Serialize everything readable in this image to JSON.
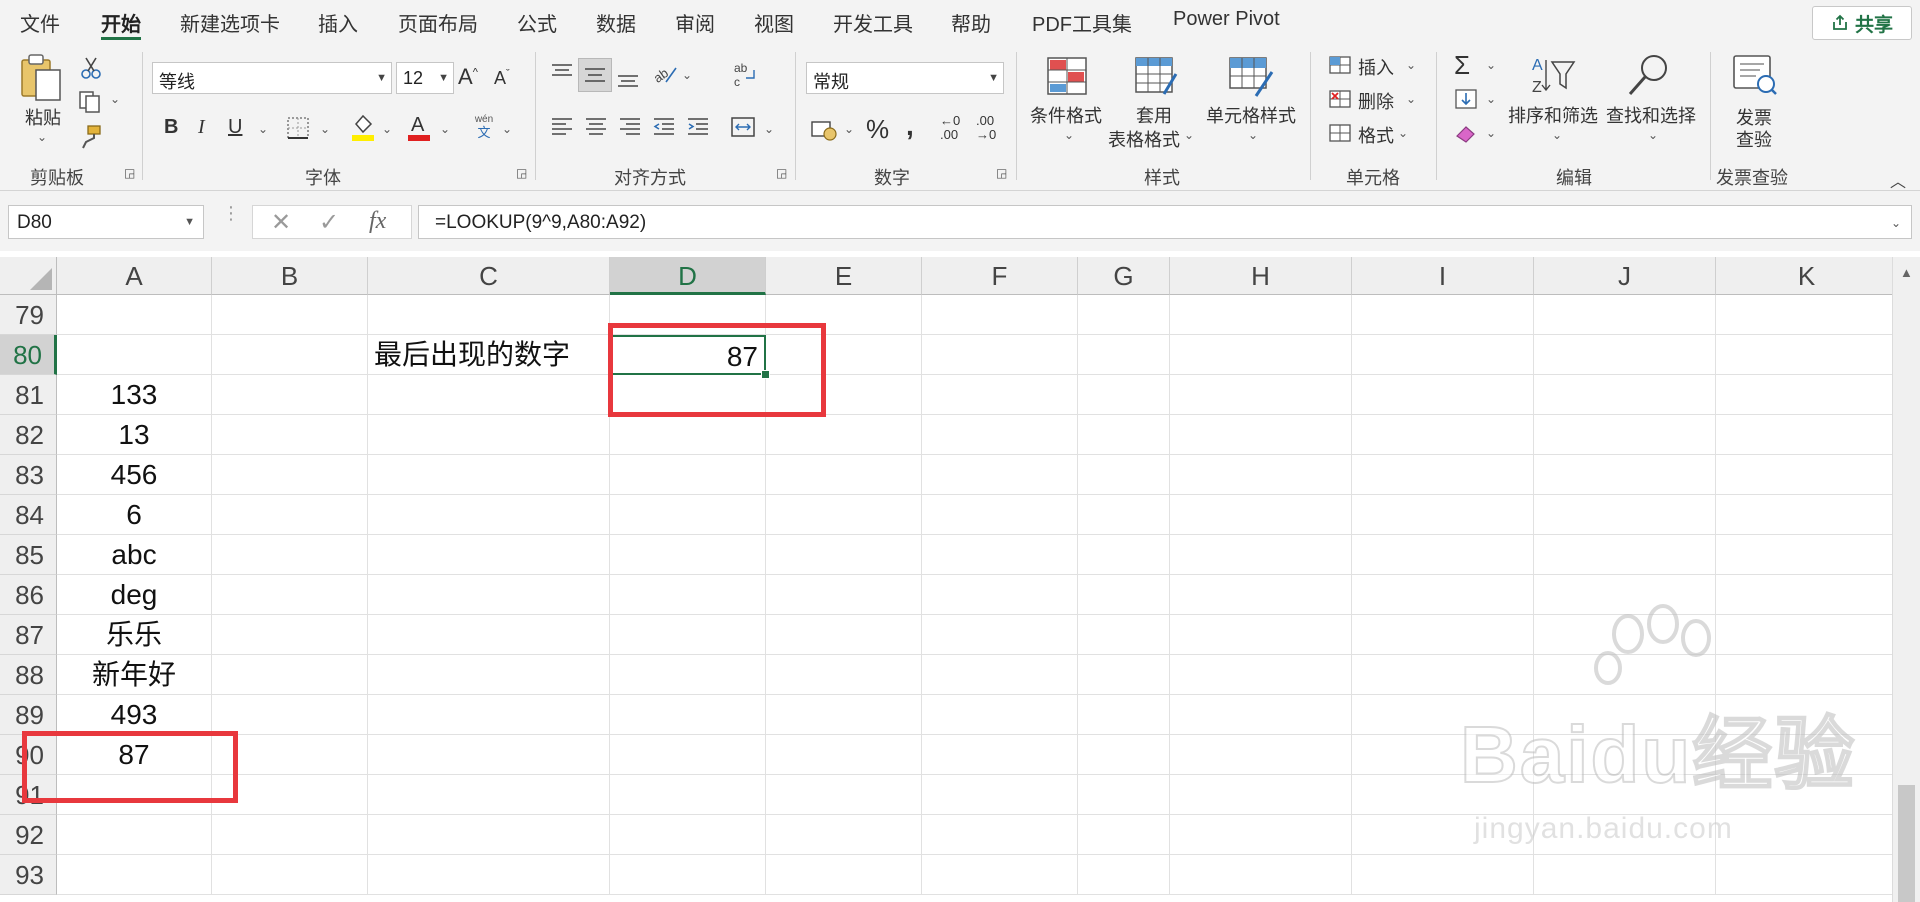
{
  "tabs": [
    {
      "label": "文件"
    },
    {
      "label": "开始"
    },
    {
      "label": "新建选项卡"
    },
    {
      "label": "插入"
    },
    {
      "label": "页面布局"
    },
    {
      "label": "公式"
    },
    {
      "label": "数据"
    },
    {
      "label": "审阅"
    },
    {
      "label": "视图"
    },
    {
      "label": "开发工具"
    },
    {
      "label": "帮助"
    },
    {
      "label": "PDF工具集"
    },
    {
      "label": "Power Pivot"
    }
  ],
  "share_label": "共享",
  "ribbon": {
    "clipboard": {
      "group": "剪贴板",
      "paste": "粘贴"
    },
    "font": {
      "group": "字体",
      "name": "等线",
      "size": "12",
      "phonetic_top": "wén",
      "phonetic_bottom": "文"
    },
    "alignment": {
      "group": "对齐方式"
    },
    "number": {
      "group": "数字",
      "format": "常规"
    },
    "styles": {
      "group": "样式",
      "conditional": "条件格式",
      "table_format_1": "套用",
      "table_format_2": "表格格式",
      "cell_styles": "单元格样式"
    },
    "cells": {
      "group": "单元格",
      "insert": "插入",
      "delete": "删除",
      "format": "格式"
    },
    "editing": {
      "group": "编辑",
      "sort_filter": "排序和筛选",
      "find_select": "查找和选择"
    },
    "invoice": {
      "group": "发票查验",
      "label_1": "发票",
      "label_2": "查验"
    }
  },
  "namebox": "D80",
  "formula": "=LOOKUP(9^9,A80:A92)",
  "columns": [
    "A",
    "B",
    "C",
    "D",
    "E",
    "F",
    "G",
    "H",
    "I",
    "J",
    "K"
  ],
  "selected_column": "D",
  "rows": [
    {
      "n": "79",
      "a": "",
      "c": "",
      "d": ""
    },
    {
      "n": "80",
      "a": "",
      "c": "最后出现的数字",
      "d": "87"
    },
    {
      "n": "81",
      "a": "133",
      "c": "",
      "d": ""
    },
    {
      "n": "82",
      "a": "13",
      "c": "",
      "d": ""
    },
    {
      "n": "83",
      "a": "456",
      "c": "",
      "d": ""
    },
    {
      "n": "84",
      "a": "6",
      "c": "",
      "d": ""
    },
    {
      "n": "85",
      "a": "abc",
      "c": "",
      "d": ""
    },
    {
      "n": "86",
      "a": "deg",
      "c": "",
      "d": ""
    },
    {
      "n": "87",
      "a": "乐乐",
      "c": "",
      "d": ""
    },
    {
      "n": "88",
      "a": "新年好",
      "c": "",
      "d": ""
    },
    {
      "n": "89",
      "a": "493",
      "c": "",
      "d": ""
    },
    {
      "n": "90",
      "a": "87",
      "c": "",
      "d": ""
    },
    {
      "n": "91",
      "a": "",
      "c": "",
      "d": ""
    },
    {
      "n": "92",
      "a": "",
      "c": "",
      "d": ""
    },
    {
      "n": "93",
      "a": "",
      "c": "",
      "d": ""
    }
  ],
  "selected_row": "80",
  "watermark": {
    "brand": "Baidu经验",
    "url": "jingyan.baidu.com"
  },
  "colors": {
    "accent": "#217346",
    "highlight_box": "#e8383d"
  }
}
